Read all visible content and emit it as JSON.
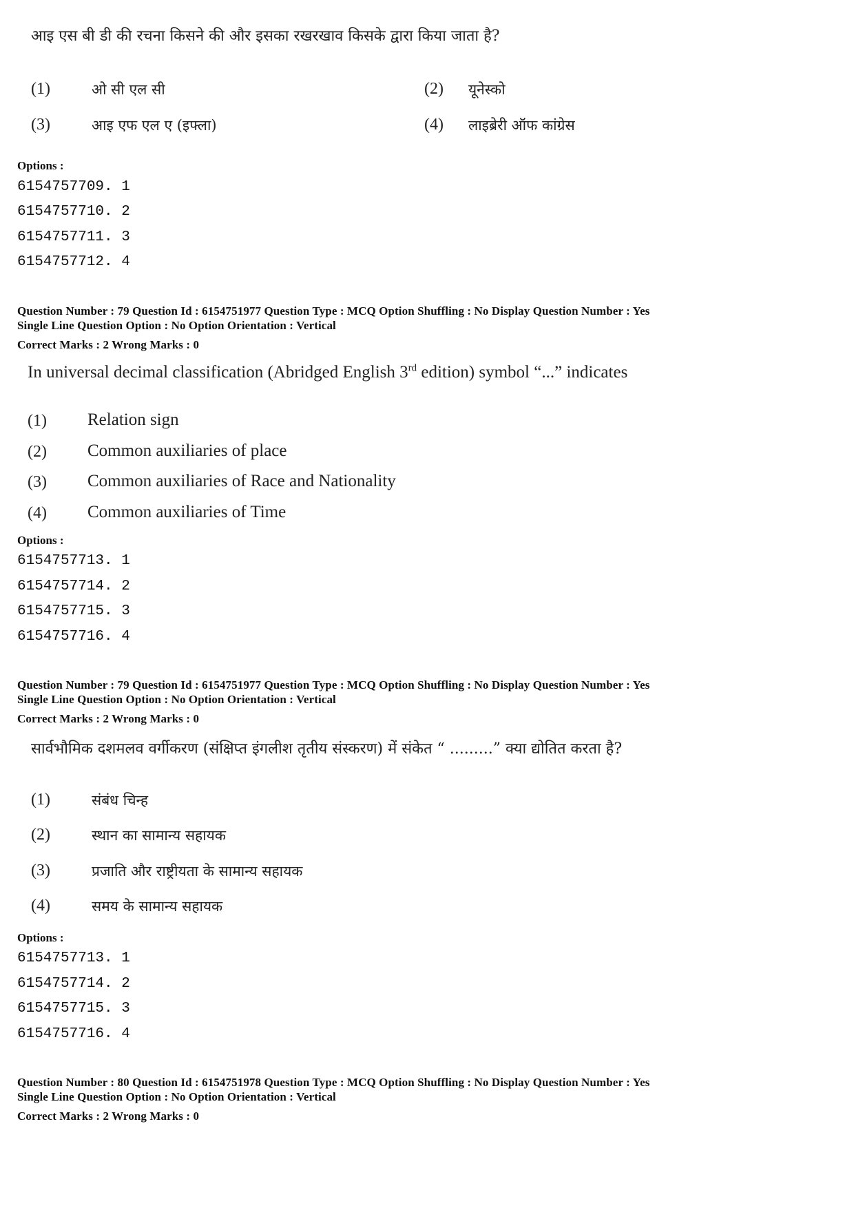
{
  "block1": {
    "question_text": "आइ एस बी डी की रचना किसने की और इसका रखरखाव किसके द्वारा किया जाता है?",
    "choices": [
      {
        "num": "(1)",
        "text": "ओ सी एल सी"
      },
      {
        "num": "(2)",
        "text": "यूनेस्को"
      },
      {
        "num": "(3)",
        "text": "आइ एफ एल ए (इफ्ला)"
      },
      {
        "num": "(4)",
        "text": "लाइब्रेरी ऑफ कांग्रेस"
      }
    ],
    "options_label": "Options :",
    "option_ids": [
      "6154757709. 1",
      "6154757710. 2",
      "6154757711. 3",
      "6154757712. 4"
    ]
  },
  "block2": {
    "meta_line1": "Question Number : 79  Question Id : 6154751977  Question Type : MCQ  Option Shuffling : No  Display Question Number : Yes",
    "meta_line2": "Single Line Question Option : No  Option Orientation : Vertical",
    "meta_line3": "Correct Marks : 2  Wrong Marks : 0",
    "question_pre": "In universal decimal classification (Abridged English 3",
    "question_sup": "rd",
    "question_post": " edition) symbol “...” indicates",
    "choices": [
      {
        "num": "(1)",
        "text": "Relation sign"
      },
      {
        "num": "(2)",
        "text": "Common auxiliaries of place"
      },
      {
        "num": "(3)",
        "text": "Common auxiliaries of Race and Nationality"
      },
      {
        "num": "(4)",
        "text": "Common auxiliaries of Time"
      }
    ],
    "options_label": "Options :",
    "option_ids": [
      "6154757713. 1",
      "6154757714. 2",
      "6154757715. 3",
      "6154757716. 4"
    ]
  },
  "block3": {
    "meta_line1": "Question Number : 79  Question Id : 6154751977  Question Type : MCQ  Option Shuffling : No  Display Question Number : Yes",
    "meta_line2": "Single Line Question Option : No  Option Orientation : Vertical",
    "meta_line3": "Correct Marks : 2  Wrong Marks : 0",
    "question_text": "सार्वभौमिक दशमलव वर्गीकरण (संक्षिप्त इंगलीश तृतीय संस्करण) में संकेत “ .........” क्या द्योतित करता है?",
    "choices": [
      {
        "num": "(1)",
        "text": "संबंध चिन्ह"
      },
      {
        "num": "(2)",
        "text": "स्थान का सामान्य सहायक"
      },
      {
        "num": "(3)",
        "text": "प्रजाति और राष्ट्रीयता के सामान्य सहायक"
      },
      {
        "num": "(4)",
        "text": "समय के सामान्य सहायक"
      }
    ],
    "options_label": "Options :",
    "option_ids": [
      "6154757713. 1",
      "6154757714. 2",
      "6154757715. 3",
      "6154757716. 4"
    ]
  },
  "block4": {
    "meta_line1": "Question Number : 80  Question Id : 6154751978  Question Type : MCQ  Option Shuffling : No  Display Question Number : Yes",
    "meta_line2": "Single Line Question Option : No  Option Orientation : Vertical",
    "meta_line3": "Correct Marks : 2  Wrong Marks : 0"
  }
}
